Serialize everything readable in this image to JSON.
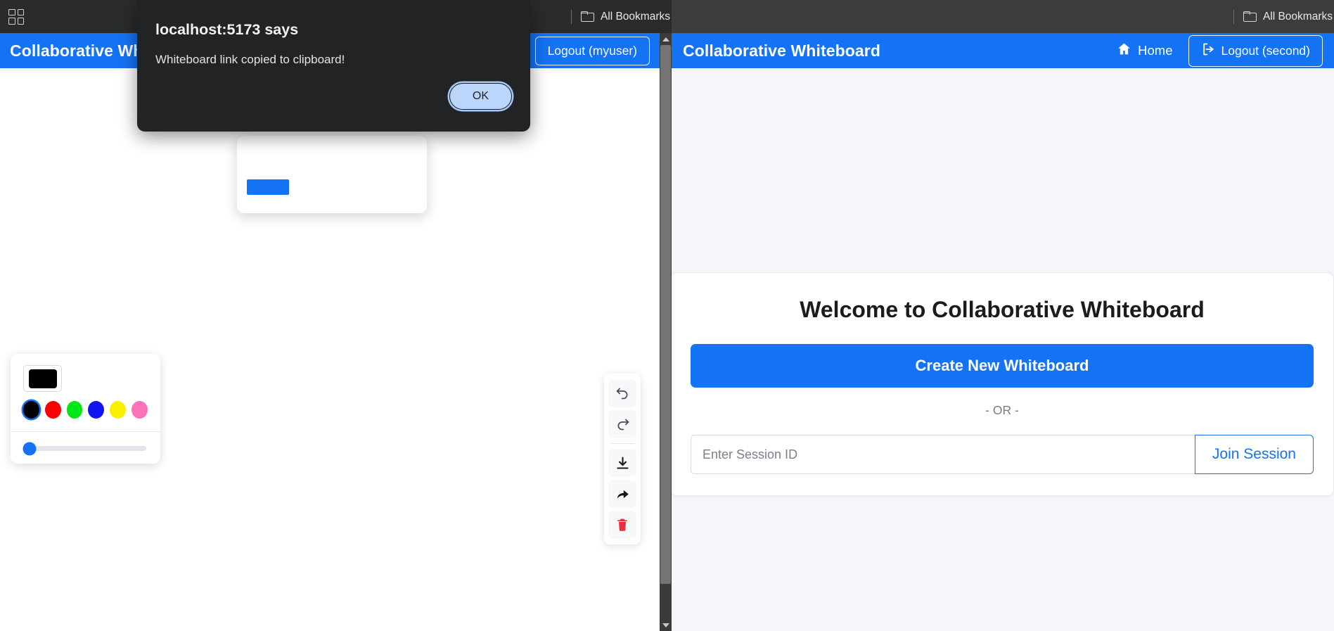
{
  "browser": {
    "apps_icon": "grid-apps-icon",
    "bookmarks_label_left": "All Bookmarks",
    "bookmarks_label_right": "All Bookmarks",
    "folder_icon": "folder-icon"
  },
  "left_app": {
    "header": {
      "title": "Collaborative Whiteboard",
      "logout_label": "Logout (myuser)"
    },
    "color_toolbar": {
      "current_color": "#000000",
      "swatch_icon": "color-swatch-icon",
      "palette": [
        {
          "name": "black",
          "hex": "#000000",
          "selected": true
        },
        {
          "name": "red",
          "hex": "#fb0000",
          "selected": false
        },
        {
          "name": "green",
          "hex": "#00e617",
          "selected": false
        },
        {
          "name": "blue",
          "hex": "#1414f0",
          "selected": false
        },
        {
          "name": "yellow",
          "hex": "#f8f001",
          "selected": false
        },
        {
          "name": "pink",
          "hex": "#fb72b8",
          "selected": false
        }
      ],
      "stroke_width_percent": 5
    },
    "vertical_tools": [
      {
        "name": "undo-icon",
        "title": "Undo"
      },
      {
        "name": "redo-icon",
        "title": "Redo"
      },
      {
        "name": "download-icon",
        "title": "Download"
      },
      {
        "name": "share-icon",
        "title": "Share"
      },
      {
        "name": "delete-icon",
        "title": "Delete",
        "color": "#eb2d3f"
      }
    ],
    "scrollbar": {
      "up_arrow": "scroll-up-icon",
      "down_arrow": "scroll-down-icon"
    }
  },
  "right_app": {
    "header": {
      "title": "Collaborative Whiteboard",
      "home_label": "Home",
      "home_icon": "home-icon",
      "logout_label": "Logout (second)",
      "logout_icon": "logout-icon"
    },
    "card": {
      "welcome_title": "Welcome to Collaborative Whiteboard",
      "create_button": "Create New Whiteboard",
      "or_divider": "- OR -",
      "session_placeholder": "Enter Session ID",
      "session_value": "",
      "join_button": "Join Session"
    }
  },
  "dialog": {
    "title": "localhost:5173 says",
    "message": "Whiteboard link copied to clipboard!",
    "ok_label": "OK"
  },
  "colors": {
    "accent": "#1473f5",
    "chrome_bg": "#2b2b2b",
    "dialog_bg": "#222325",
    "page_bg": "#f4f6f9",
    "danger": "#eb2d3f"
  }
}
